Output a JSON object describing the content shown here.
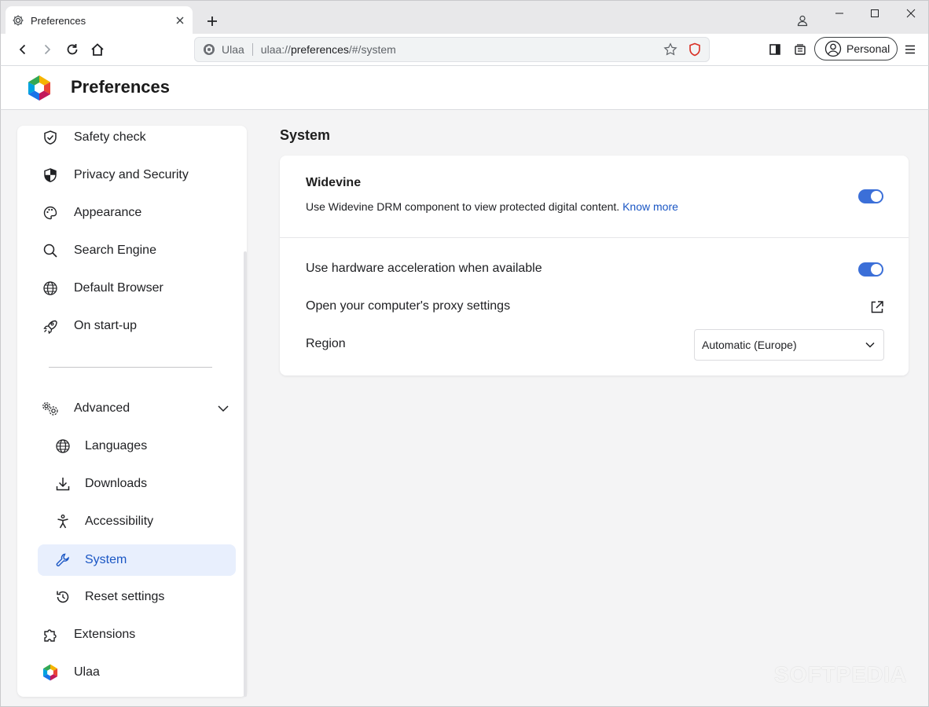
{
  "browser": {
    "tab": {
      "title": "Preferences"
    },
    "omnibox": {
      "brand": "Ulaa",
      "url_scheme": "ulaa://",
      "url_host": "preferences",
      "url_path": "/#/system"
    },
    "profile": {
      "label": "Personal"
    }
  },
  "header": {
    "title": "Preferences"
  },
  "sidebar": {
    "items": [
      {
        "label": "Safety check",
        "icon": "shield-check-icon"
      },
      {
        "label": "Privacy and Security",
        "icon": "shield-half-icon"
      },
      {
        "label": "Appearance",
        "icon": "palette-icon"
      },
      {
        "label": "Search Engine",
        "icon": "search-icon"
      },
      {
        "label": "Default Browser",
        "icon": "globe-icon"
      },
      {
        "label": "On start-up",
        "icon": "rocket-icon"
      }
    ],
    "advanced": {
      "label": "Advanced",
      "icon": "gears-icon",
      "expanded": true
    },
    "advanced_items": [
      {
        "label": "Languages",
        "icon": "globe-icon"
      },
      {
        "label": "Downloads",
        "icon": "download-icon"
      },
      {
        "label": "Accessibility",
        "icon": "accessibility-icon"
      },
      {
        "label": "System",
        "icon": "wrench-icon",
        "active": true
      },
      {
        "label": "Reset settings",
        "icon": "reset-icon"
      }
    ],
    "bottom_items": [
      {
        "label": "Extensions",
        "icon": "puzzle-icon"
      },
      {
        "label": "Ulaa",
        "icon": "ulaa-logo-icon"
      }
    ]
  },
  "main": {
    "section_title": "System",
    "widevine": {
      "title": "Widevine",
      "description": "Use Widevine DRM component to view protected digital content.",
      "link": "Know more",
      "enabled": true
    },
    "hardware_acceleration": {
      "label": "Use hardware acceleration when available",
      "enabled": true
    },
    "proxy": {
      "label": "Open your computer's proxy settings"
    },
    "region": {
      "label": "Region",
      "value": "Automatic (Europe)"
    }
  },
  "colors": {
    "accent": "#3b6fd8",
    "link": "#1a56c4",
    "active_bg": "#e8effd",
    "page_bg": "#f4f4f5"
  },
  "watermark": "SOFTPEDIA"
}
